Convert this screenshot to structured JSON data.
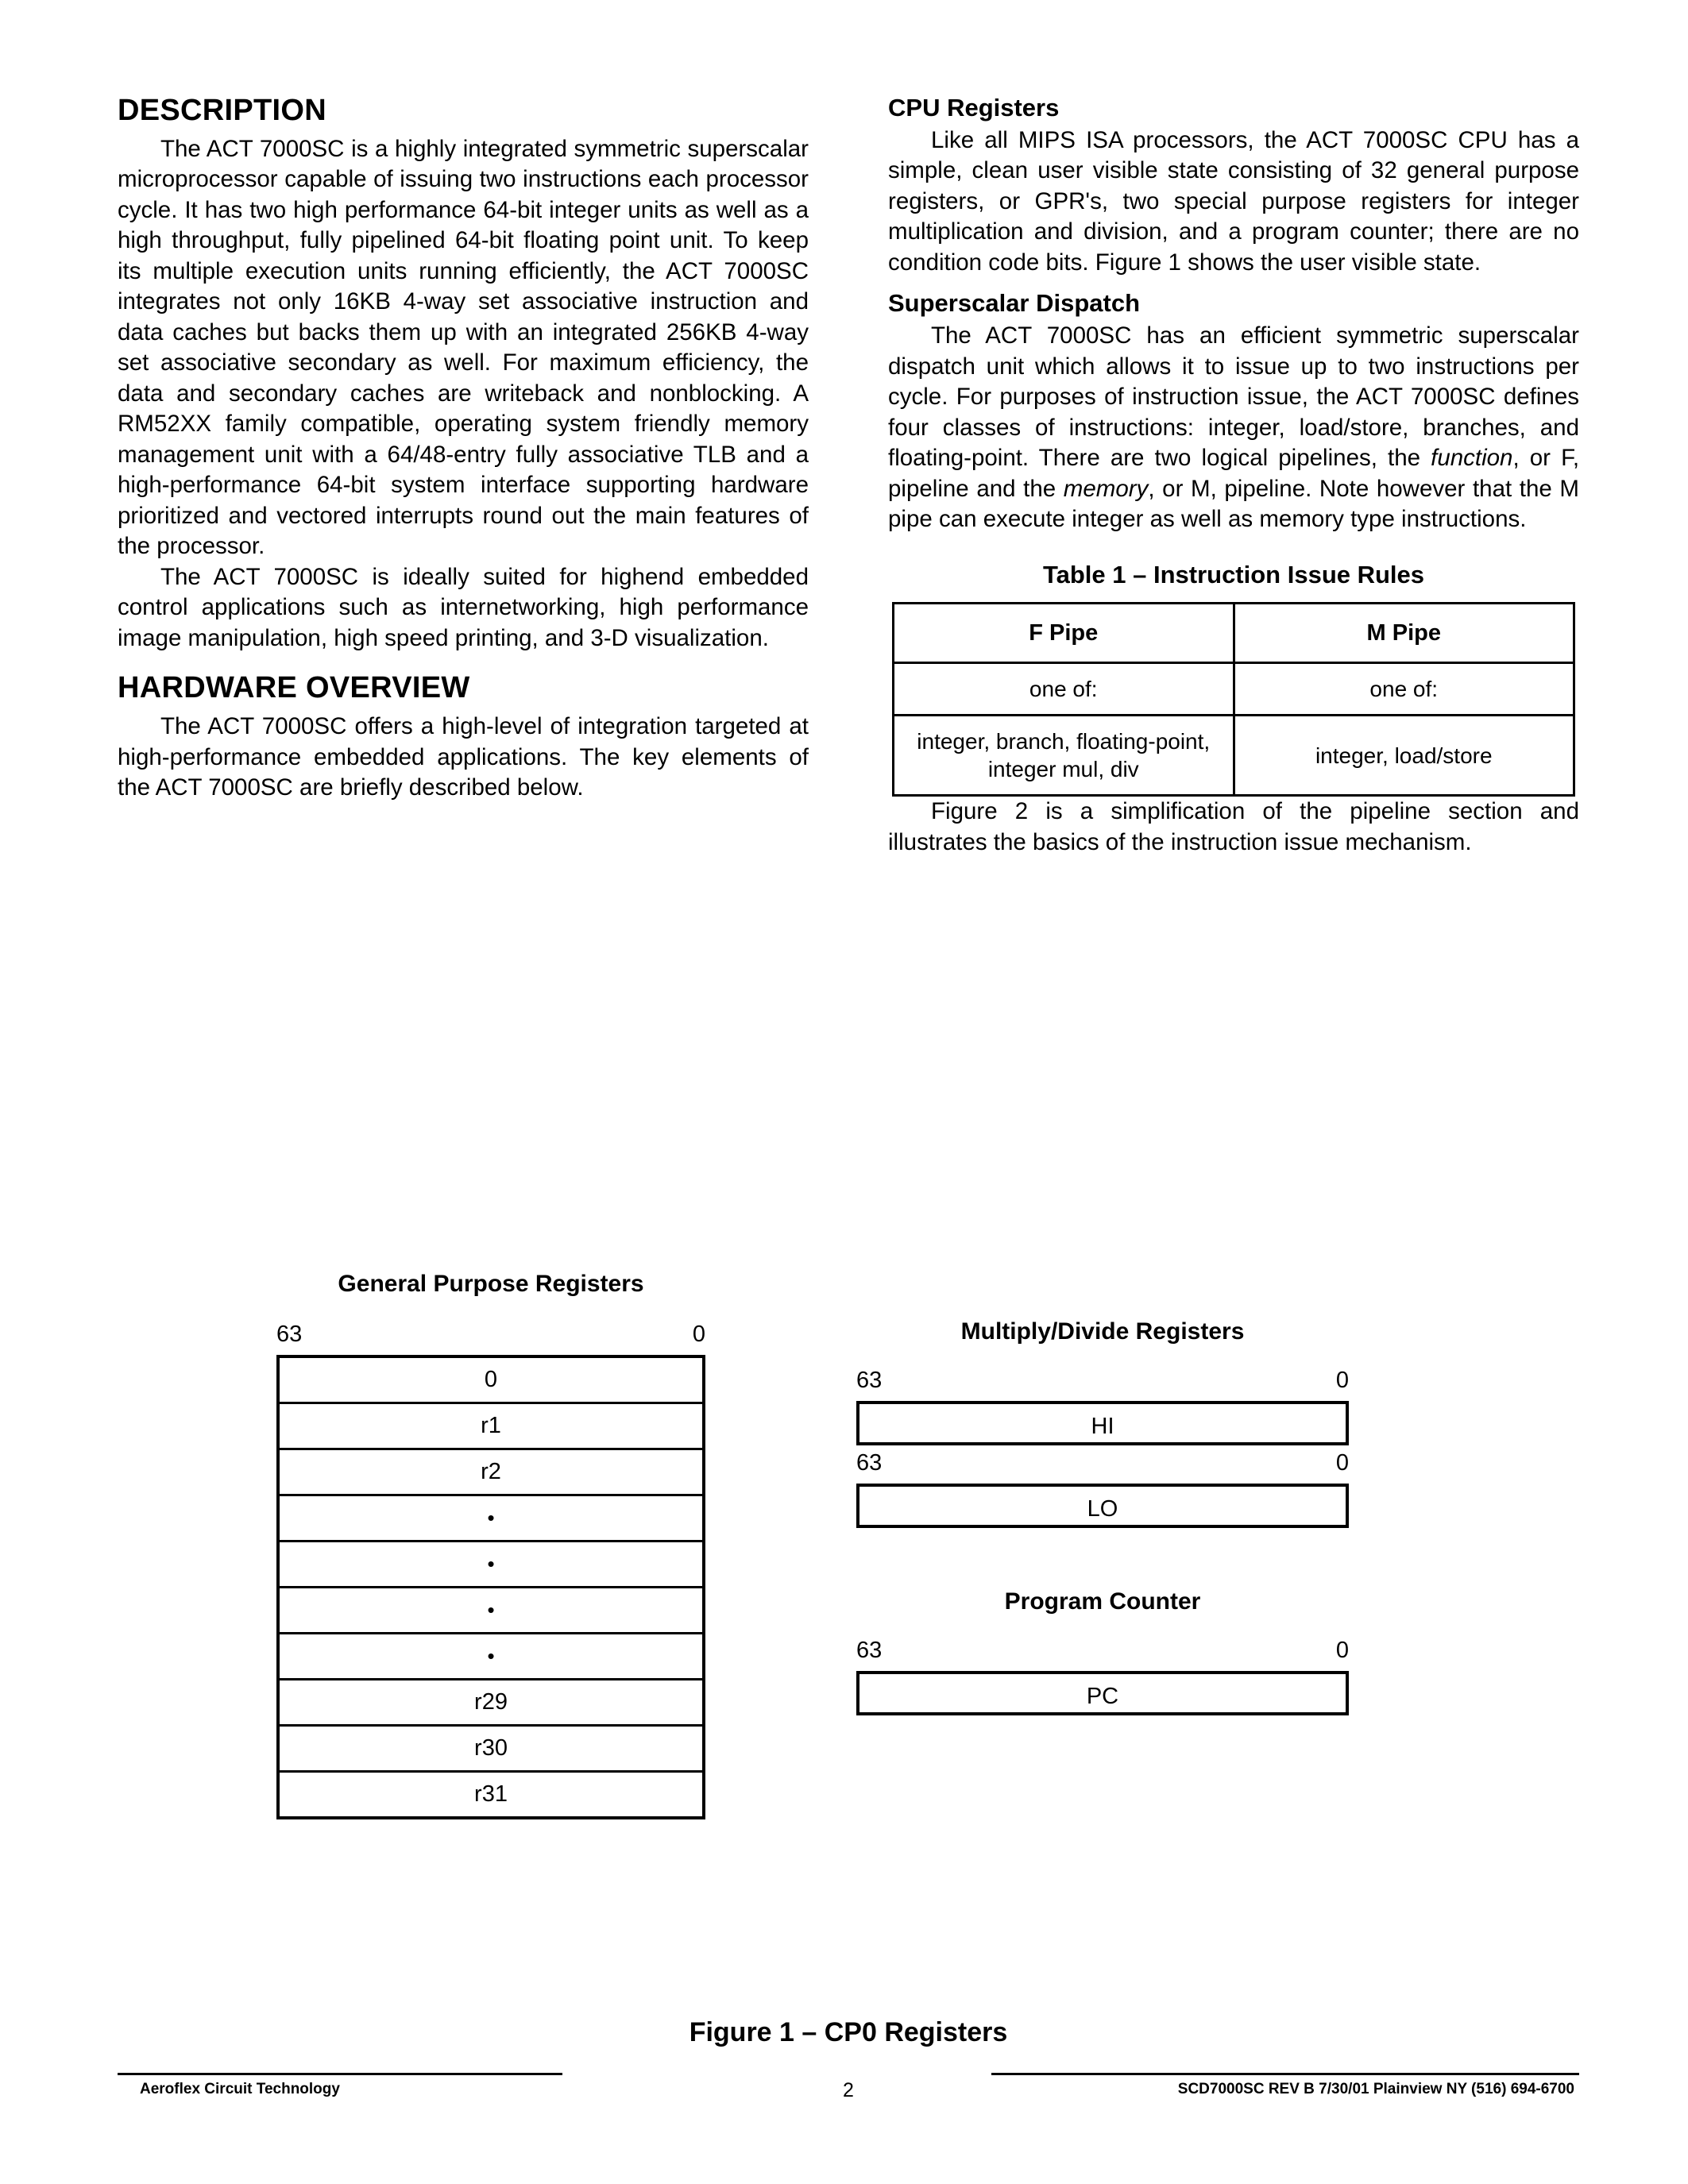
{
  "left_column": {
    "heading_description": "DESCRIPTION",
    "paragraph_1": "The ACT 7000SC is a highly integrated symmetric superscalar microprocessor capable of issuing two instructions each processor cycle. It has two high performance 64-bit integer units as well as a high throughput, fully pipelined 64-bit floating point unit. To keep its multiple execution units running efficiently, the ACT 7000SC integrates not only 16KB 4-way set associative instruction and data caches but backs them up with an integrated 256KB 4-way set associative secondary as well. For maximum efficiency, the data and secondary caches are writeback and nonblocking. A RM52XX family compatible, operating system friendly memory management unit with a 64/48-entry fully associative TLB and a high-performance 64-bit system interface supporting hardware prioritized and vectored interrupts round out the main features of the processor.",
    "paragraph_2": "The ACT 7000SC is ideally suited for highend embedded control applications such as internetworking, high performance image manipulation, high speed printing, and 3-D visualization.",
    "heading_hardware": "HARDWARE OVERVIEW",
    "paragraph_3": "The ACT 7000SC offers a high-level of integration targeted at high-performance embedded applications. The key elements of the ACT 7000SC are briefly described below."
  },
  "right_column": {
    "heading_cpu_registers": "CPU Registers",
    "paragraph_1": "Like all MIPS ISA processors, the ACT 7000SC CPU has a simple, clean user visible state consisting of 32 general purpose registers, or GPR's, two special purpose registers for integer multiplication and division, and a program counter; there are no condition code bits. Figure 1 shows the user visible state.",
    "heading_superscalar": "Superscalar Dispatch",
    "paragraph_2_part1": "The ACT 7000SC has an efficient symmetric superscalar dispatch unit which allows it to issue up to two instructions per cycle. For purposes of instruction issue, the ACT 7000SC defines four classes of instructions: integer, load/store, branches, and floating-point. There are two logical pipelines, the ",
    "paragraph_2_italic1": "function",
    "paragraph_2_part2": ", or F, pipeline and the ",
    "paragraph_2_italic2": "memory",
    "paragraph_2_part3": ", or M, pipeline. Note however that the M pipe can execute integer as well as memory type instructions.",
    "table_title": "Table 1 – Instruction Issue Rules",
    "table": {
      "headers": [
        "F Pipe",
        "M Pipe"
      ],
      "rows": [
        [
          "one of:",
          "one of:"
        ],
        [
          "integer, branch, floating-point,\ninteger mul, div",
          "integer, load/store"
        ]
      ]
    },
    "paragraph_3": "Figure 2 is a simplification of the pipeline section and illustrates the basics of the instruction issue mechanism."
  },
  "figure": {
    "gpr_title": "General Purpose Registers",
    "gpr_bit_high": "63",
    "gpr_bit_low": "0",
    "gpr_rows": [
      "0",
      "r1",
      "r2",
      "•",
      "•",
      "•",
      "•",
      "r29",
      "r30",
      "r31"
    ],
    "md_title": "Multiply/Divide Registers",
    "md_hi_bit_high": "63",
    "md_hi_bit_low": "0",
    "md_hi_label": "HI",
    "md_lo_bit_high": "63",
    "md_lo_bit_low": "0",
    "md_lo_label": "LO",
    "pc_title": "Program Counter",
    "pc_bit_high": "63",
    "pc_bit_low": "0",
    "pc_label": "PC",
    "caption": "Figure 1 – CP0 Registers"
  },
  "footer": {
    "left": "Aeroflex Circuit Technology",
    "page_number": "2",
    "right": "SCD7000SC REV B  7/30/01 Plainview NY (516) 694-6700"
  }
}
